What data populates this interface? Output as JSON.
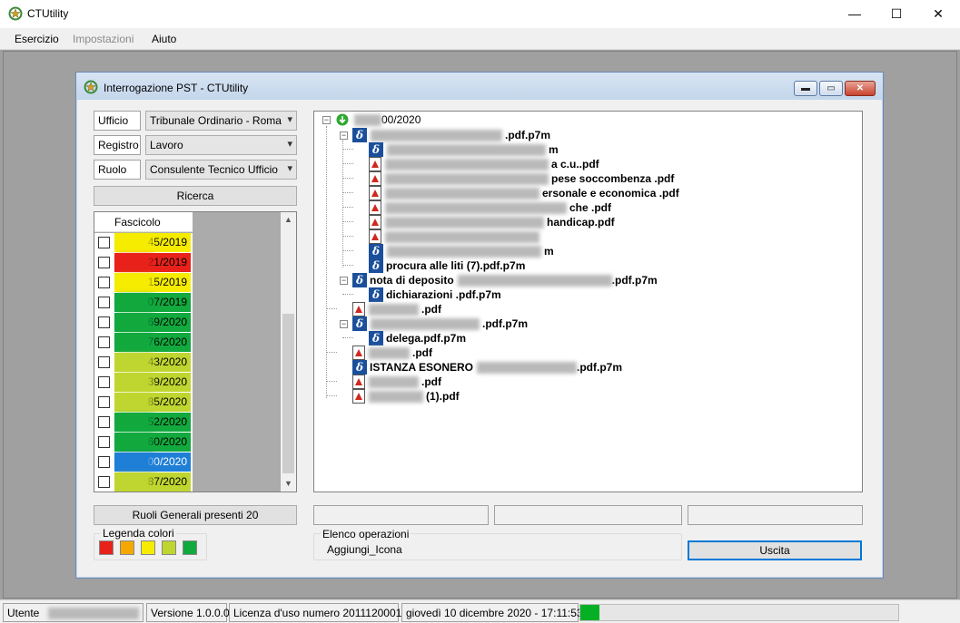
{
  "window": {
    "title": "CTUtility",
    "controls": {
      "minimize": "—",
      "maximize": "☐",
      "close": "✕"
    }
  },
  "menu": [
    "Esercizio",
    "Impostazioni",
    "Aiuto"
  ],
  "dialog": {
    "title": "Interrogazione PST - CTUtility",
    "filters": {
      "ufficio_label": "Ufficio",
      "ufficio_value": "Tribunale Ordinario - Roma",
      "registro_label": "Registro",
      "registro_value": "Lavoro",
      "ruolo_label": "Ruolo",
      "ruolo_value": "Consulente Tecnico Ufficio"
    },
    "search_button": "Ricerca",
    "grid": {
      "header": "Fascicolo",
      "rows": [
        {
          "suffix": "45/2019",
          "color": "#f5ec00"
        },
        {
          "suffix": "21/2019",
          "color": "#e8221b"
        },
        {
          "suffix": "15/2019",
          "color": "#f5ec00"
        },
        {
          "suffix": "07/2019",
          "color": "#12a93e"
        },
        {
          "suffix": "69/2020",
          "color": "#12a93e"
        },
        {
          "suffix": "76/2020",
          "color": "#12a93e"
        },
        {
          "suffix": "43/2020",
          "color": "#bfd630"
        },
        {
          "suffix": "39/2020",
          "color": "#bfd630"
        },
        {
          "suffix": "85/2020",
          "color": "#bfd630"
        },
        {
          "suffix": "52/2020",
          "color": "#12a93e"
        },
        {
          "suffix": "60/2020",
          "color": "#12a93e"
        },
        {
          "suffix": "00/2020",
          "color": "#1f7fd6",
          "selected": true
        },
        {
          "suffix": "87/2020",
          "color": "#bfd630"
        }
      ]
    },
    "tree": {
      "root": "00/2020",
      "nodes": [
        {
          "text": ".pdf.p7m",
          "icon": "sig"
        },
        {
          "text": "m",
          "icon": "sig"
        },
        {
          "text": "a c.u..pdf",
          "icon": "pdf"
        },
        {
          "text": "pese soccombenza .pdf",
          "icon": "pdf"
        },
        {
          "text": "ersonale e economica .pdf",
          "icon": "pdf"
        },
        {
          "text": "che .pdf",
          "icon": "pdf"
        },
        {
          "text": "handicap.pdf",
          "icon": "pdf"
        },
        {
          "text": "",
          "icon": "pdf"
        },
        {
          "text": "m",
          "icon": "sig"
        },
        {
          "text": "procura alle liti  (7).pdf.p7m",
          "icon": "sig"
        },
        {
          "text": "nota di deposito",
          "icon": "sig",
          "suffix": ".pdf.p7m"
        },
        {
          "text": "dichiarazioni .pdf.p7m",
          "icon": "sig"
        },
        {
          "text": ".pdf",
          "icon": "pdf"
        },
        {
          "text": ".pdf.p7m",
          "icon": "sig"
        },
        {
          "text": "delega.pdf.p7m",
          "icon": "sig"
        },
        {
          "text": ".pdf",
          "icon": "pdf"
        },
        {
          "text": "ISTANZA ESONERO",
          "icon": "sig",
          "suffix": ".pdf.p7m"
        },
        {
          "text": ".pdf",
          "icon": "pdf"
        },
        {
          "text": " (1).pdf",
          "icon": "pdf"
        }
      ]
    },
    "ruoli_button": "Ruoli Generali presenti 20",
    "legend": {
      "title": "Legenda colori",
      "colors": [
        "#e8221b",
        "#f5a800",
        "#f5ec00",
        "#bfd630",
        "#12a93e"
      ]
    },
    "operations": {
      "title": "Elenco operazioni",
      "item": "Aggiungi_Icona"
    },
    "exit_button": "Uscita"
  },
  "statusbar": {
    "utente_label": "Utente",
    "versione": "Versione 1.0.0.0",
    "licenza": "Licenza d'uso numero 2011120001",
    "datetime": "giovedì 10 dicembre 2020 - 17:11:53",
    "progress": 0.06
  }
}
